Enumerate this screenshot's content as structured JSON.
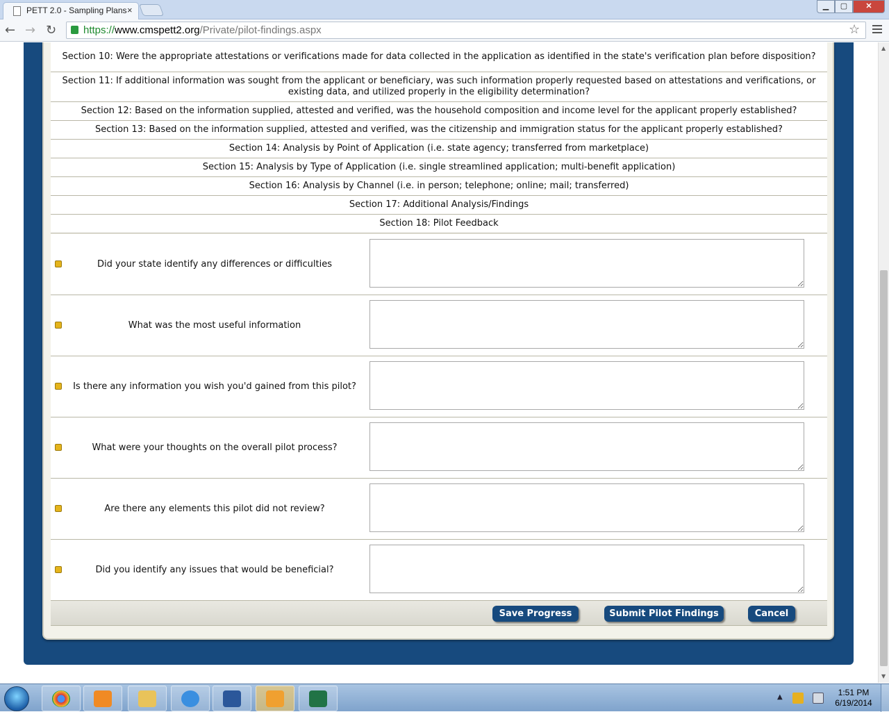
{
  "browser": {
    "tab_title": "PETT 2.0 - Sampling Plans",
    "tab_close": "×",
    "url_scheme": "https://",
    "url_host": "www.cmspett2.org",
    "url_path": "/Private/pilot-findings.aspx"
  },
  "sections": [
    {
      "label": "Section 10: Were the appropriate attestations or verifications made for data collected in the application as identified in the state's verification plan before disposition?"
    },
    {
      "label": "Section 11: If additional information was sought from the applicant or beneficiary, was such information properly requested based on attestations and verifications, or existing data, and utilized properly in the eligibility determination?"
    },
    {
      "label": "Section 12: Based on the information supplied, attested and verified, was the household composition and income level for the applicant properly established?"
    },
    {
      "label": "Section 13: Based on the information supplied, attested and verified, was the citizenship and immigration status for the applicant properly established?"
    },
    {
      "label": "Section 14: Analysis by Point of Application (i.e. state agency; transferred from marketplace)"
    },
    {
      "label": "Section 15: Analysis by Type of Application (i.e. single streamlined application; multi-benefit application)"
    },
    {
      "label": "Section 16: Analysis by Channel (i.e. in person; telephone; online; mail; transferred)"
    },
    {
      "label": "Section 17: Additional Analysis/Findings"
    },
    {
      "label": "Section 18: Pilot Feedback"
    }
  ],
  "questions": [
    {
      "label": "Did your state identify any differences or difficulties",
      "value": ""
    },
    {
      "label": "What was the most useful information",
      "value": ""
    },
    {
      "label": "Is there any information you wish you'd gained from this pilot?",
      "value": ""
    },
    {
      "label": "What were your thoughts on the overall pilot process?",
      "value": ""
    },
    {
      "label": "Are there any elements this pilot did not review?",
      "value": ""
    },
    {
      "label": "Did you identify any issues that would be beneficial?",
      "value": ""
    }
  ],
  "actions": {
    "save_label": "Save Progress",
    "submit_label": "Submit Pilot Findings",
    "cancel_label": "Cancel"
  },
  "taskbar": {
    "time": "1:51 PM",
    "date": "6/19/2014",
    "apps": [
      "chrome-icon",
      "media-player-icon",
      "file-explorer-icon",
      "internet-explorer-icon",
      "word-icon",
      "outlook-icon",
      "excel-icon"
    ]
  },
  "colors": {
    "brand_blue": "#174a7e",
    "bullet_gold": "#e5b41c",
    "panel_bg": "#f3f2ea"
  }
}
